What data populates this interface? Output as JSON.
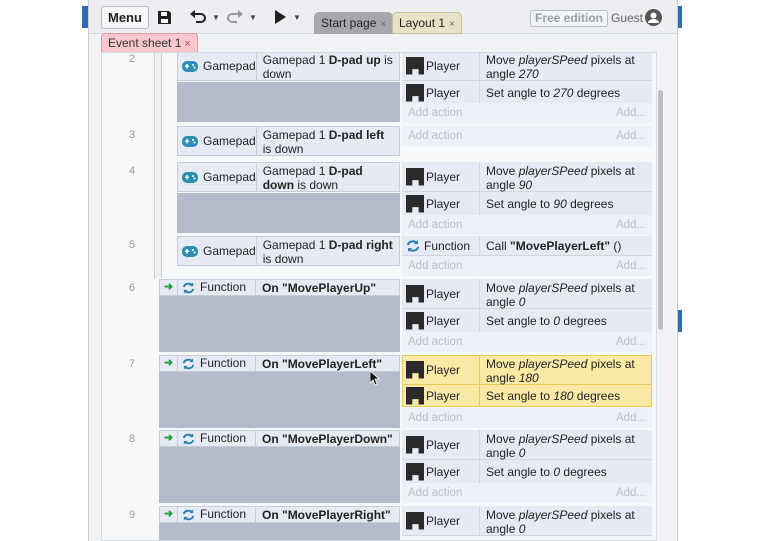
{
  "toolbar": {
    "menu_label": "Menu",
    "tabs": [
      {
        "label": "Start page",
        "close": "×"
      },
      {
        "label": "Layout 1",
        "close": "×"
      }
    ],
    "edition_label": "Free edition",
    "user_label": "Guest"
  },
  "sheet_tab": {
    "label": "Event sheet 1",
    "close": "×"
  },
  "add_action": {
    "left": "Add action",
    "right": "Add..."
  },
  "events": [
    {
      "number": "2",
      "cond_object": "Gamepad",
      "cond_text_pre": "Gamepad 1 ",
      "cond_text_bold": "D-pad up",
      "cond_text_post": " is down",
      "actions": [
        {
          "object": "Player",
          "text": "Move playerSPeed pixels at angle 270"
        },
        {
          "object": "Player",
          "text": "Set angle to 270 degrees"
        }
      ]
    },
    {
      "number": "3",
      "cond_object": "Gamepad",
      "cond_text_pre": "Gamepad 1 ",
      "cond_text_bold": "D-pad left",
      "cond_text_post": " is down",
      "actions": []
    },
    {
      "number": "4",
      "cond_object": "Gamepad",
      "cond_text_pre": "Gamepad 1 ",
      "cond_text_bold": "D-pad down",
      "cond_text_post": " is down",
      "actions": [
        {
          "object": "Player",
          "text": "Move playerSPeed pixels at angle 90"
        },
        {
          "object": "Player",
          "text": "Set angle to 90 degrees"
        }
      ]
    },
    {
      "number": "5",
      "cond_object": "Gamepad",
      "cond_text_pre": "Gamepad 1 ",
      "cond_text_bold": "D-pad right",
      "cond_text_post": " is down",
      "actions": [
        {
          "object": "Function",
          "text": "Call \"MovePlayerLeft\" ()"
        }
      ]
    },
    {
      "number": "6",
      "cond_object": "Function",
      "cond_text": "On \"MovePlayerUp\"",
      "actions": [
        {
          "object": "Player",
          "text": "Move playerSPeed pixels at angle 0"
        },
        {
          "object": "Player",
          "text": "Set angle to 0 degrees"
        }
      ]
    },
    {
      "number": "7",
      "cond_object": "Function",
      "cond_text": "On \"MovePlayerLeft\"",
      "actions": [
        {
          "object": "Player",
          "text": "Move playerSPeed pixels at angle 180"
        },
        {
          "object": "Player",
          "text": "Set angle to 180 degrees"
        }
      ]
    },
    {
      "number": "8",
      "cond_object": "Function",
      "cond_text": "On \"MovePlayerDown\"",
      "actions": [
        {
          "object": "Player",
          "text": "Move playerSPeed pixels at angle 0"
        },
        {
          "object": "Player",
          "text": "Set angle to 0 degrees"
        }
      ]
    },
    {
      "number": "9",
      "cond_object": "Function",
      "cond_text": "On \"MovePlayerRight\"",
      "actions": [
        {
          "object": "Player",
          "text": "Move playerSPeed pixels at angle 0"
        }
      ]
    }
  ]
}
